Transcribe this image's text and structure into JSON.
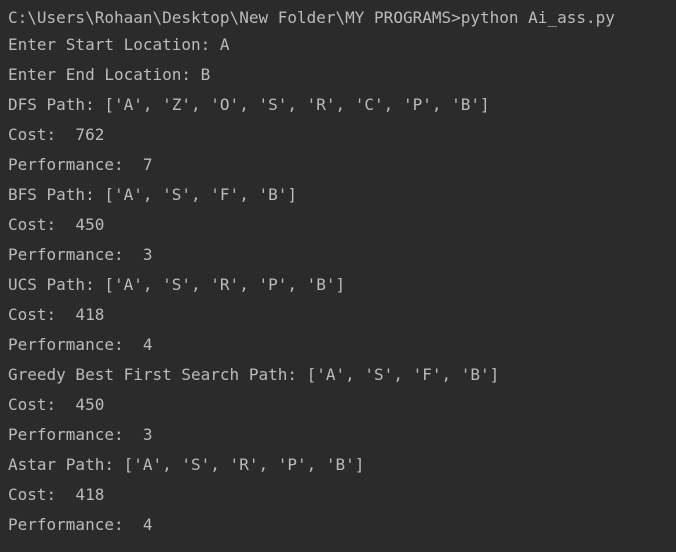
{
  "terminal": {
    "background": "#2b2b2b",
    "text_color": "#bbbbbb",
    "lines": [
      "C:\\Users\\Rohaan\\Desktop\\New Folder\\MY PROGRAMS>python Ai_ass.py",
      "Enter Start Location: A",
      "Enter End Location: B",
      "DFS Path: ['A', 'Z', 'O', 'S', 'R', 'C', 'P', 'B']",
      "Cost:  762",
      "Performance:  7",
      "BFS Path: ['A', 'S', 'F', 'B']",
      "Cost:  450",
      "Performance:  3",
      "UCS Path: ['A', 'S', 'R', 'P', 'B']",
      "Cost:  418",
      "Performance:  4",
      "Greedy Best First Search Path: ['A', 'S', 'F', 'B']",
      "Cost:  450",
      "Performance:  3",
      "Astar Path: ['A', 'S', 'R', 'P', 'B']",
      "Cost:  418",
      "Performance:  4"
    ]
  }
}
